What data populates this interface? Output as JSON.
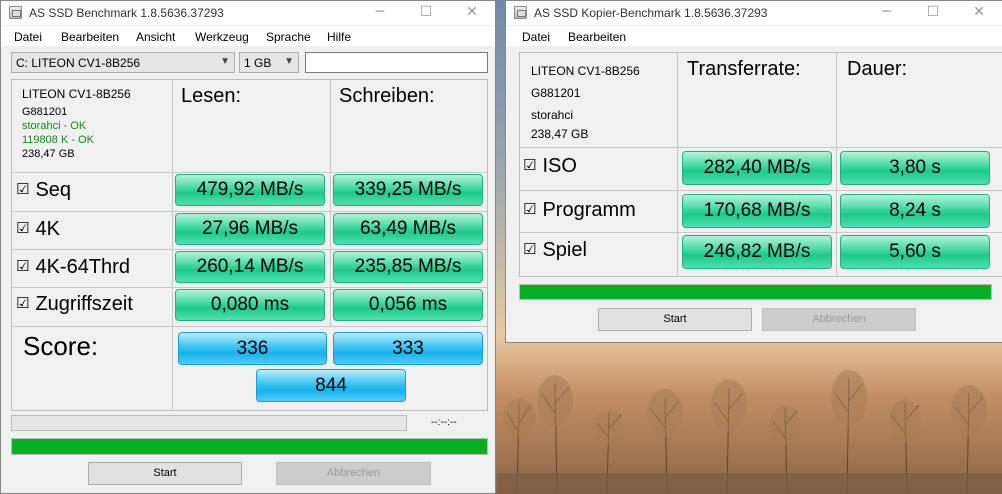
{
  "bench": {
    "title": "AS SSD Benchmark 1.8.5636.37293",
    "menu": [
      "Datei",
      "Bearbeiten",
      "Ansicht",
      "Werkzeug",
      "Sprache",
      "Hilfe"
    ],
    "drive_select": "C: LITEON CV1-8B256",
    "size_select": "1 GB",
    "info": [
      "LITEON CV1-8B256",
      "G881201",
      "storahci - OK",
      "119808 K - OK",
      "238,47 GB"
    ],
    "col_read": "Lesen:",
    "col_write": "Schreiben:",
    "rows": [
      {
        "label": "Seq",
        "read": "479,92 MB/s",
        "write": "339,25 MB/s"
      },
      {
        "label": "4K",
        "read": "27,96 MB/s",
        "write": "63,49 MB/s"
      },
      {
        "label": "4K-64Thrd",
        "read": "260,14 MB/s",
        "write": "235,85 MB/s"
      },
      {
        "label": "Zugriffszeit",
        "read": "0,080 ms",
        "write": "0,056 ms"
      }
    ],
    "score_label": "Score:",
    "score_read": "336",
    "score_write": "333",
    "score_total": "844",
    "time_text": "--:--:--",
    "progress_main": 1.0,
    "start_label": "Start",
    "abort_label": "Abbrechen"
  },
  "copy": {
    "title": "AS SSD Kopier-Benchmark 1.8.5636.37293",
    "menu": [
      "Datei",
      "Bearbeiten"
    ],
    "info": [
      "LITEON CV1-8B256",
      "G881201",
      "storahci",
      "238,47 GB"
    ],
    "col_rate": "Transferrate:",
    "col_time": "Dauer:",
    "rows": [
      {
        "label": "ISO",
        "rate": "282,40 MB/s",
        "time": "3,80 s"
      },
      {
        "label": "Programm",
        "rate": "170,68 MB/s",
        "time": "8,24 s"
      },
      {
        "label": "Spiel",
        "rate": "246,82 MB/s",
        "time": "5,60 s"
      }
    ],
    "progress": 1.0,
    "start_label": "Start",
    "abort_label": "Abbrechen"
  },
  "icons": {
    "checkbox": "checkbox-checked-icon",
    "app": "app-drive-icon"
  },
  "colors": {
    "result_green": "#2fd39a",
    "score_blue": "#26baf0",
    "progress_green": "#06b025"
  }
}
